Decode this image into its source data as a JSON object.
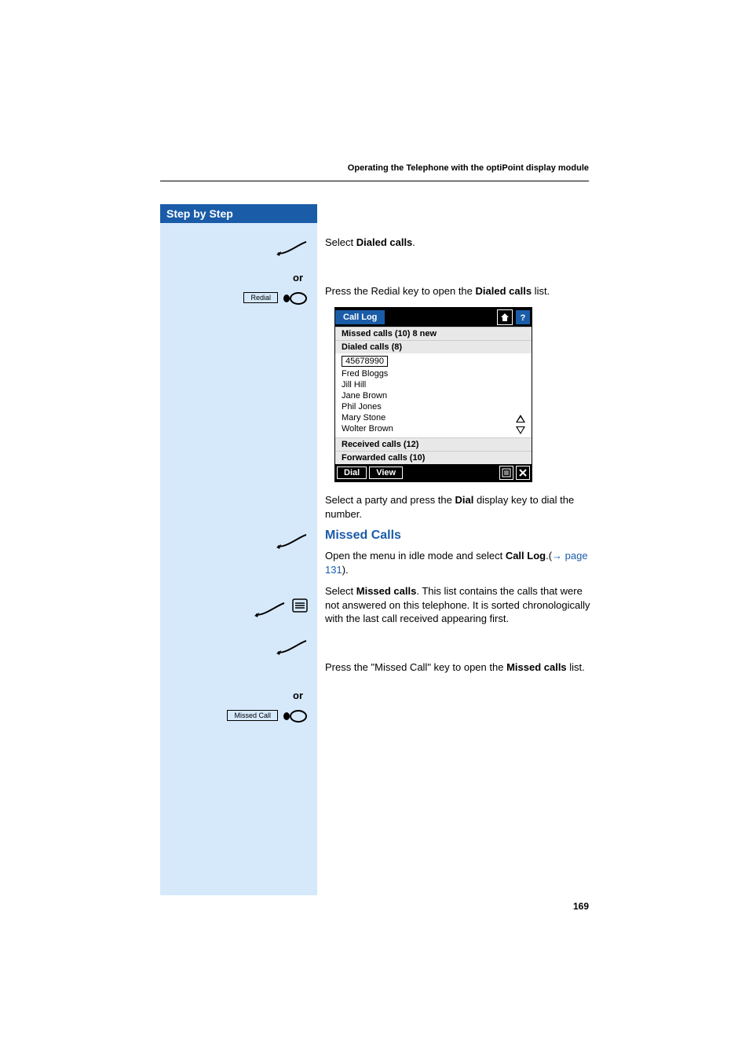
{
  "header": {
    "running_title": "Operating the Telephone with the optiPoint display module"
  },
  "sidebar": {
    "title": "Step by Step",
    "or_label": "or",
    "keys": {
      "redial": "Redial",
      "missed_call": "Missed Call"
    }
  },
  "content": {
    "p1_prefix": "Select ",
    "p1_bold": "Dialed calls",
    "p1_suffix": ".",
    "p2_prefix": "Press the Redial key to open the ",
    "p2_bold": "Dialed calls",
    "p2_suffix": " list.",
    "p3_prefix": "Select a party and press the ",
    "p3_bold": "Dial",
    "p3_suffix": " display key to dial the number.",
    "section_title": "Missed Calls",
    "p4_prefix": "Open the menu in idle mode and select ",
    "p4_bold": "Call Log",
    "p4_suffix1": ".(",
    "p4_arrow": "→",
    "p4_pageref": " page 131",
    "p4_suffix2": ").",
    "p5_prefix": "Select ",
    "p5_bold": "Missed calls",
    "p5_suffix": ". This list contains the calls that were not answered on this telephone. It is sorted chronologically with the last call received appearing first.",
    "p6_prefix": "Press the \"Missed Call\" key to open the ",
    "p6_bold": "Missed calls",
    "p6_suffix": " list."
  },
  "phone_screen": {
    "title": "Call Log",
    "groups": {
      "missed": "Missed calls (10) 8 new",
      "dialed": "Dialed calls (8)",
      "received": "Received calls (12)",
      "forwarded": "Forwarded calls (10)"
    },
    "entries": [
      "45678990",
      "Fred Bloggs",
      "Jill Hill",
      "Jane Brown",
      "Phil Jones",
      "Mary Stone",
      "Wolter Brown"
    ],
    "footer": {
      "dial": "Dial",
      "view": "View"
    }
  },
  "page_number": "169"
}
